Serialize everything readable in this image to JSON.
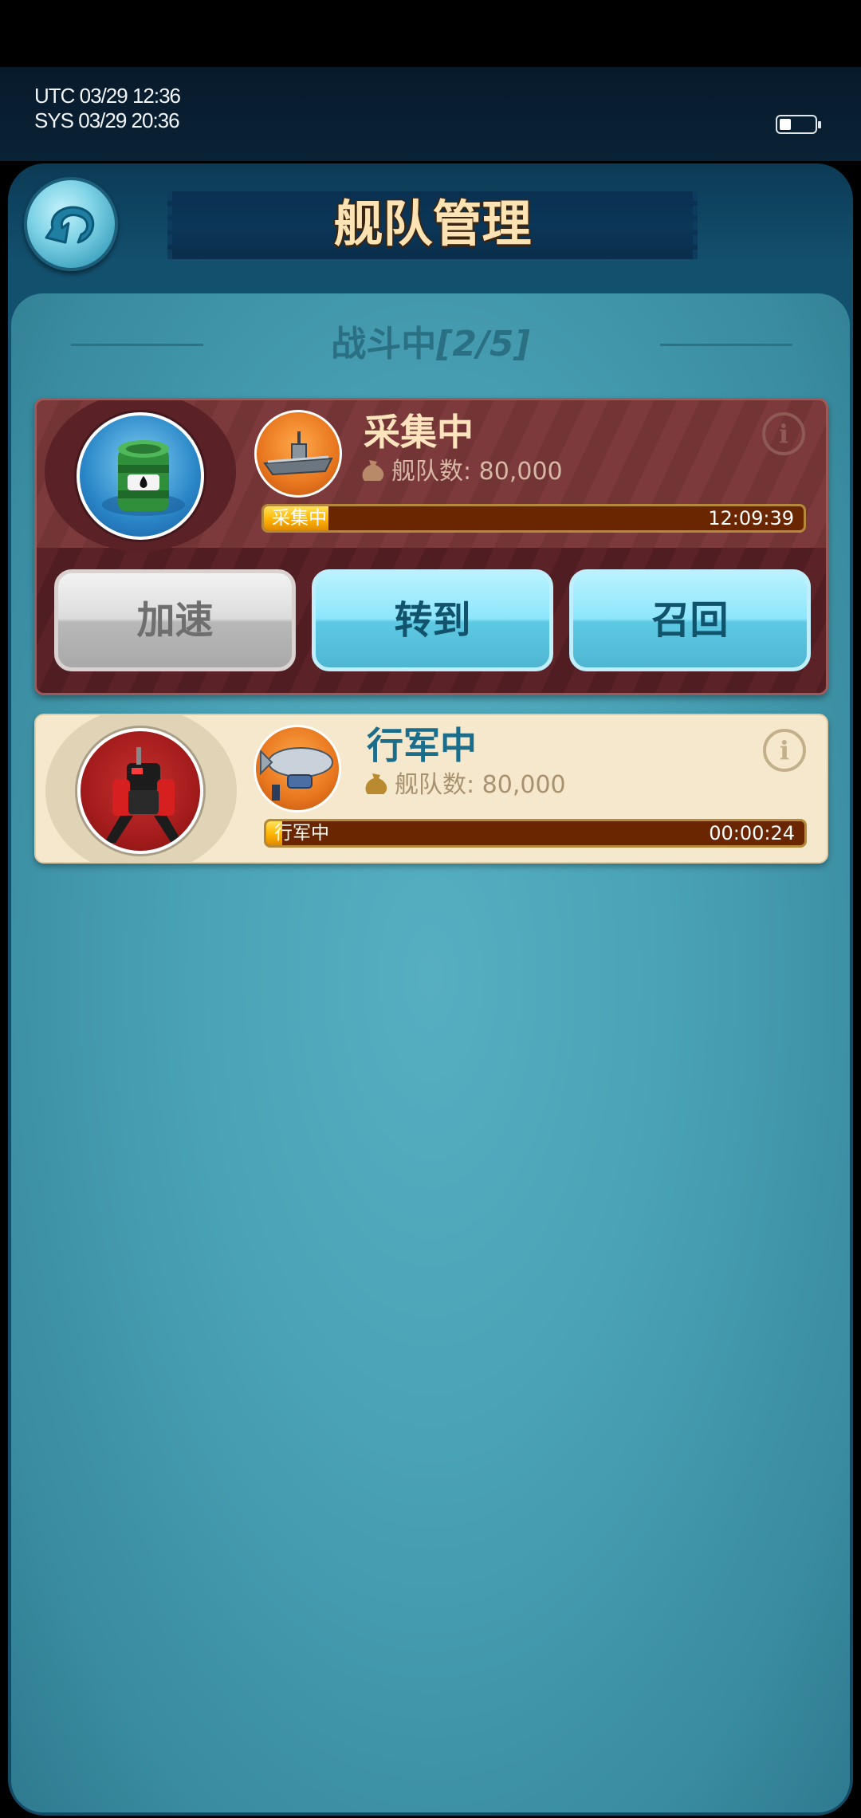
{
  "status_bar": {
    "utc": "UTC 03/29 12:36",
    "sys": "SYS 03/29 20:36"
  },
  "header": {
    "title": "舰队管理"
  },
  "section": {
    "title_prefix": "战斗中",
    "title_count": "[2/5]"
  },
  "fleets": [
    {
      "status": "采集中",
      "count_label": "舰队数: 80,000",
      "progress_label": "采集中",
      "progress_fraction": 0.12,
      "time": "12:09:39",
      "buttons": {
        "speedup": "加速",
        "goto": "转到",
        "recall": "召回"
      }
    },
    {
      "status": "行军中",
      "count_label": "舰队数: 80,000",
      "progress_label": "行军中",
      "progress_fraction": 0.03,
      "time": "00:00:24"
    }
  ],
  "colors": {
    "title_text": "#fce3b3",
    "active_card": "#7c3a3c",
    "idle_card": "#f6e8cd",
    "progress_fill": "#ffb300",
    "button_blue": "#8de6fb"
  },
  "icons": {
    "back": "back-arrow-icon",
    "info": "info-icon",
    "bag": "resource-bag-icon"
  }
}
